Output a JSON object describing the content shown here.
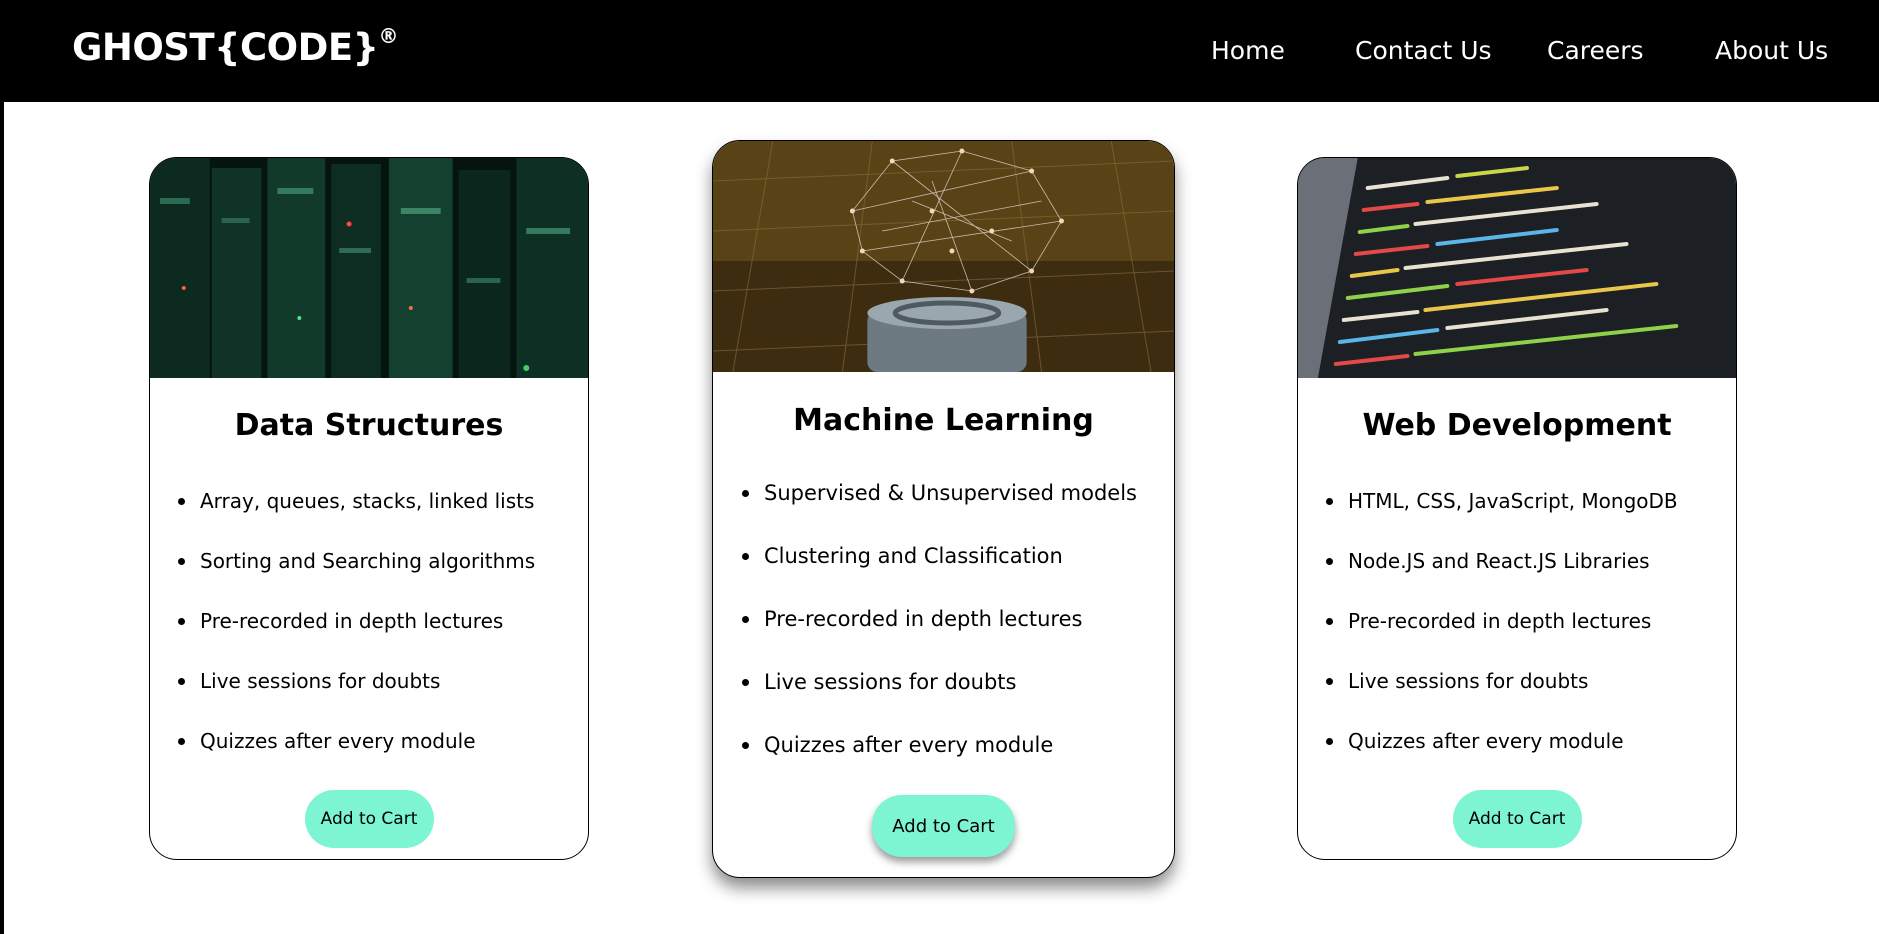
{
  "nav": {
    "logo": "GHOST{CODE}",
    "logo_mark": "®",
    "links": [
      "Home",
      "Contact Us",
      "Careers",
      "About Us"
    ]
  },
  "cards": [
    {
      "title": "Data Structures",
      "image": "server-racks-image",
      "features": [
        "Array, queues, stacks, linked lists",
        "Sorting and Searching algorithms",
        "Pre-recorded in depth lectures",
        "Live sessions for doubts",
        "Quizzes after every module"
      ],
      "button": "Add to Cart"
    },
    {
      "title": "Machine Learning",
      "image": "neural-network-image",
      "features": [
        "Supervised & Unsupervised models",
        "Clustering and Classification",
        "Pre-recorded in depth lectures",
        "Live sessions for doubts",
        "Quizzes after every module"
      ],
      "button": "Add to Cart"
    },
    {
      "title": "Web Development",
      "image": "code-screen-image",
      "features": [
        "HTML, CSS, JavaScript, MongoDB",
        "Node.JS and React.JS Libraries",
        "Pre-recorded in depth lectures",
        "Live sessions for doubts",
        "Quizzes after every module"
      ],
      "button": "Add to Cart"
    }
  ],
  "colors": {
    "navbar": "#000000",
    "button": "#7df5d2",
    "background": "#ffffff"
  }
}
